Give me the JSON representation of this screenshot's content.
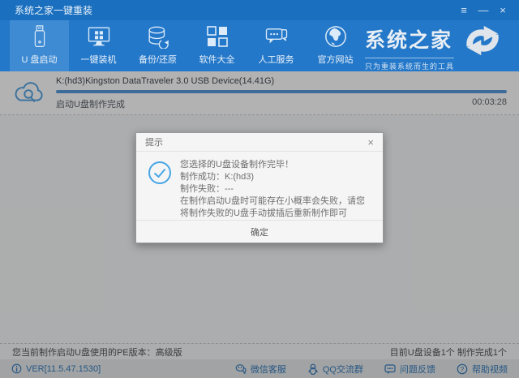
{
  "window": {
    "title": "系统之家一键重装",
    "controls": {
      "menu_icon": "≡",
      "minimize_icon": "—",
      "close_icon": "×"
    }
  },
  "nav": {
    "items": [
      {
        "label": "U 盘启动",
        "icon": "usb-drive-icon",
        "selected": true
      },
      {
        "label": "一键装机",
        "icon": "monitor-windows-icon",
        "selected": false
      },
      {
        "label": "备份/还原",
        "icon": "backup-restore-icon",
        "selected": false
      },
      {
        "label": "软件大全",
        "icon": "software-grid-icon",
        "selected": false
      },
      {
        "label": "人工服务",
        "icon": "support-chat-icon",
        "selected": false
      },
      {
        "label": "官方网站",
        "icon": "globe-icon",
        "selected": false
      }
    ],
    "brand": {
      "name": "系统之家",
      "tagline": "只为重装系统而生的工具",
      "logo_icon": "double-arrow-logo"
    }
  },
  "device_panel": {
    "icon": "cloud-search-icon",
    "device_name": "K:(hd3)Kingston DataTraveler 3.0 USB Device(14.41G)",
    "progress_percent": 100,
    "status_text": "启动U盘制作完成",
    "elapsed_time": "00:03:28"
  },
  "dialog": {
    "title": "提示",
    "close_icon": "×",
    "status_icon": "check-circle-icon",
    "lines": {
      "line1": "您选择的U盘设备制作完毕！",
      "line2": "制作成功：K:(hd3)",
      "line3": "制作失败：---",
      "line4": "在制作启动U盘时可能存在小概率会失败，请您将制作失败的U盘手动拔插后重新制作即可"
    },
    "ok_label": "确定"
  },
  "status_bar": {
    "left_text": "您当前制作启动U盘使用的PE版本：高级版",
    "right_text": "目前U盘设备1个 制作完成1个"
  },
  "footer": {
    "info_icon": "info-circle-icon",
    "version": "VER[11.5.47.1530]",
    "links": [
      {
        "label": "微信客服",
        "icon": "wechat-icon"
      },
      {
        "label": "QQ交流群",
        "icon": "qq-icon"
      },
      {
        "label": "问题反馈",
        "icon": "feedback-bubble-icon"
      },
      {
        "label": "帮助视频",
        "icon": "help-video-icon"
      }
    ]
  },
  "colors": {
    "titlebar_blue": "#1a6fbe",
    "nav_blue": "#2478c9",
    "selected_tab_blue": "#3e8bd3",
    "progress_blue": "#4f93d6",
    "link_blue": "#2e75b5",
    "check_blue": "#46a5e5",
    "dialog_bg": "#f5f5f5"
  }
}
